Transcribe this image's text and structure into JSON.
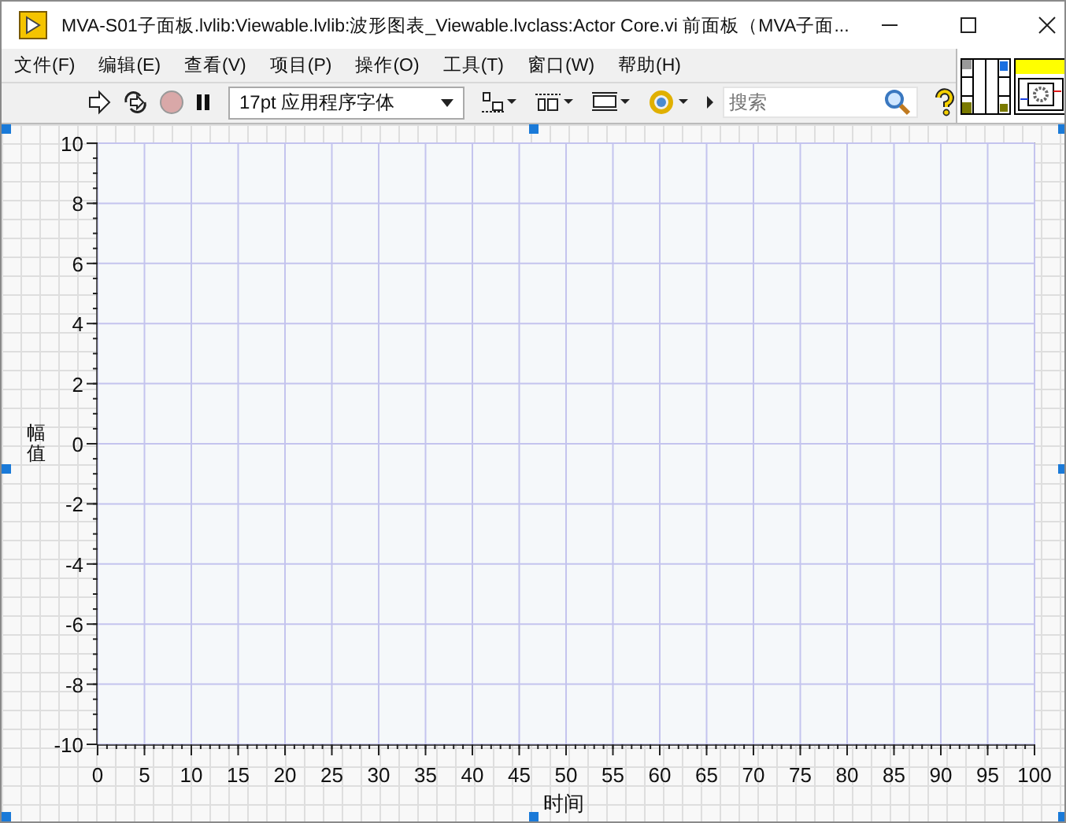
{
  "window": {
    "title": "MVA-S01子面板.lvlib:Viewable.lvlib:波形图表_Viewable.lvclass:Actor Core.vi 前面板（MVA子面..."
  },
  "menu": [
    "文件(F)",
    "编辑(E)",
    "查看(V)",
    "项目(P)",
    "操作(O)",
    "工具(T)",
    "窗口(W)",
    "帮助(H)"
  ],
  "toolbar": {
    "font": "17pt 应用程序字体",
    "search": {
      "placeholder": "搜索"
    }
  },
  "chart": {
    "chart_data": {
      "type": "line",
      "grid": true,
      "xlabel": "时间",
      "ylabel": "幅值",
      "xlim": [
        0,
        100
      ],
      "ylim": [
        -10,
        10
      ],
      "xticks": [
        0,
        5,
        10,
        15,
        20,
        25,
        30,
        35,
        40,
        45,
        50,
        55,
        60,
        65,
        70,
        75,
        80,
        85,
        90,
        95,
        100
      ],
      "yticks": [
        -10,
        -8,
        -6,
        -4,
        -2,
        0,
        2,
        4,
        6,
        8,
        10
      ]
    }
  }
}
